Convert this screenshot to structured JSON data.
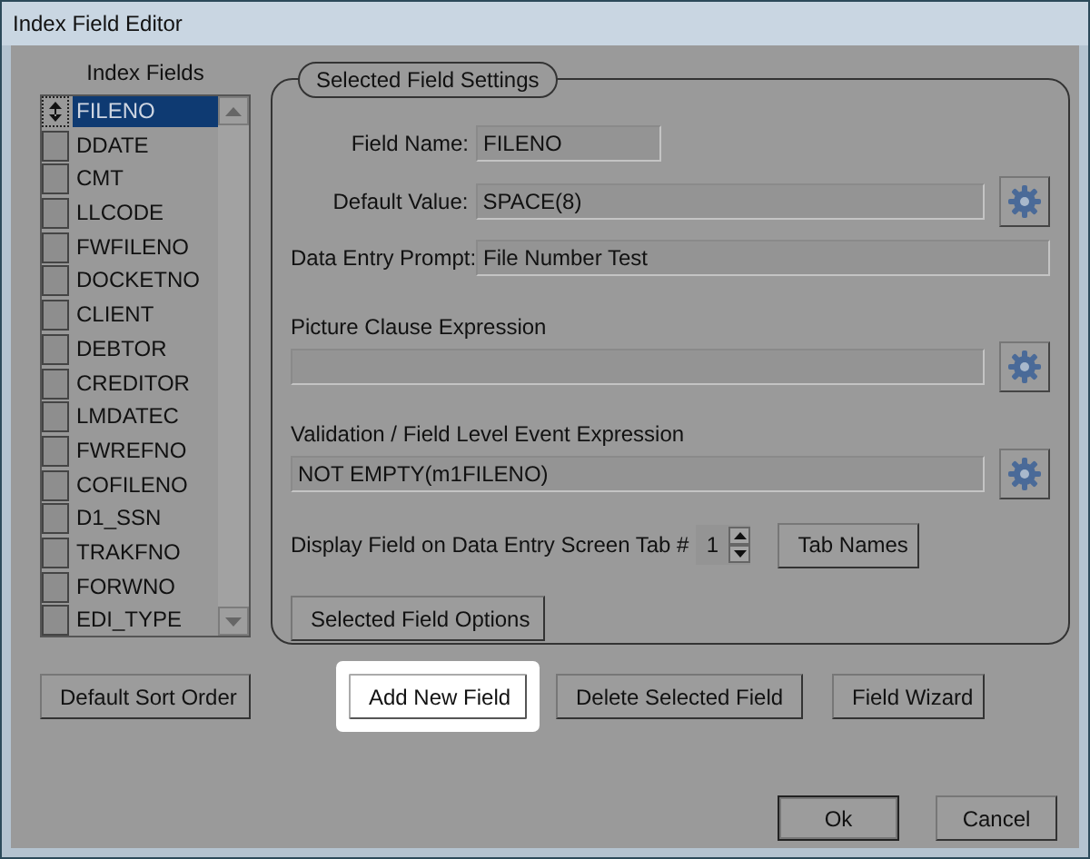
{
  "window": {
    "title": "Index Field Editor"
  },
  "index_fields": {
    "label": "Index Fields",
    "items": [
      {
        "name": "FILENO",
        "selected": true
      },
      {
        "name": "DDATE",
        "selected": false
      },
      {
        "name": "CMT",
        "selected": false
      },
      {
        "name": "LLCODE",
        "selected": false
      },
      {
        "name": "FWFILENO",
        "selected": false
      },
      {
        "name": "DOCKETNO",
        "selected": false
      },
      {
        "name": "CLIENT",
        "selected": false
      },
      {
        "name": "DEBTOR",
        "selected": false
      },
      {
        "name": "CREDITOR",
        "selected": false
      },
      {
        "name": "LMDATEC",
        "selected": false
      },
      {
        "name": "FWREFNO",
        "selected": false
      },
      {
        "name": "COFILENO",
        "selected": false
      },
      {
        "name": "D1_SSN",
        "selected": false
      },
      {
        "name": "TRAKFNO",
        "selected": false
      },
      {
        "name": "FORWNO",
        "selected": false
      },
      {
        "name": "EDI_TYPE",
        "selected": false
      }
    ]
  },
  "settings": {
    "legend": "Selected Field Settings",
    "field_name": {
      "label": "Field Name:",
      "value": "FILENO"
    },
    "default_value": {
      "label": "Default Value:",
      "value": "SPACE(8)"
    },
    "prompt": {
      "label": "Data Entry Prompt:",
      "value": "File Number Test"
    },
    "picture_clause": {
      "label": "Picture Clause Expression"
    },
    "validation": {
      "label": "Validation / Field Level Event Expression",
      "value": "NOT EMPTY(m1FILENO)"
    },
    "tab": {
      "label": "Display Field on Data Entry Screen Tab #",
      "value": "1",
      "button": "Tab Names"
    },
    "options_button": "Selected Field Options"
  },
  "action_buttons": [
    {
      "label": "Default Sort Order",
      "highlighted": false
    },
    {
      "label": "Add New Field",
      "highlighted": true
    },
    {
      "label": "Delete Selected Field",
      "highlighted": false
    },
    {
      "label": "Field Wizard",
      "highlighted": false
    }
  ],
  "dialog_buttons": [
    "Ok",
    "Cancel"
  ]
}
